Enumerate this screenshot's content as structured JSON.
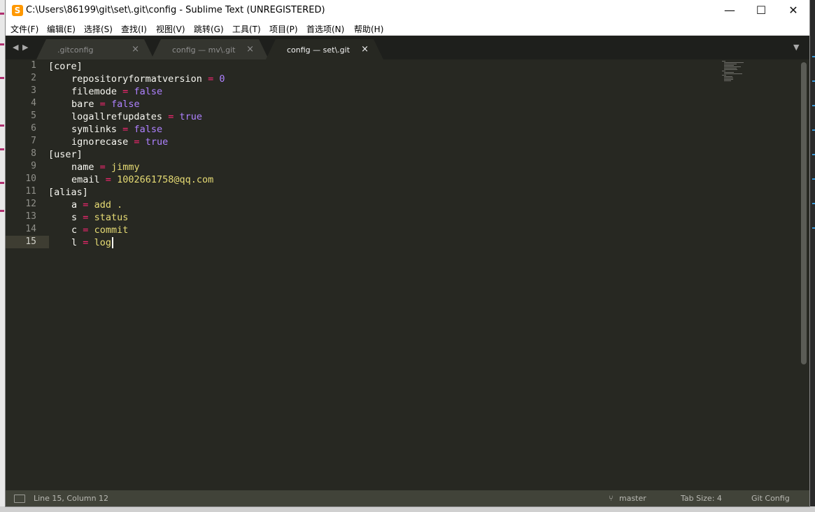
{
  "window": {
    "title": "C:\\Users\\86199\\git\\set\\.git\\config - Sublime Text (UNREGISTERED)",
    "app_icon_letter": "S",
    "accent_color": "#ff9800"
  },
  "controls": {
    "minimize": "—",
    "maximize": "☐",
    "close": "✕"
  },
  "menu": [
    "文件(F)",
    "编辑(E)",
    "选择(S)",
    "查找(I)",
    "视图(V)",
    "跳转(G)",
    "工具(T)",
    "项目(P)",
    "首选项(N)",
    "帮助(H)"
  ],
  "tabs": [
    {
      "label": ".gitconfig",
      "close": "×",
      "active": false
    },
    {
      "label": "config — mv\\.git",
      "close": "×",
      "active": false
    },
    {
      "label": "config — set\\.git",
      "close": "×",
      "active": true
    }
  ],
  "nav": {
    "back": "◀",
    "forward": "▶",
    "dropdown": "▼"
  },
  "editor": {
    "line_numbers": [
      "1",
      "2",
      "3",
      "4",
      "5",
      "6",
      "7",
      "8",
      "9",
      "10",
      "11",
      "12",
      "13",
      "14",
      "15"
    ],
    "current_line": 15,
    "lines": [
      {
        "section": "[core]"
      },
      {
        "key": "repositoryformatversion",
        "eq": "=",
        "value": "0",
        "type": "num"
      },
      {
        "key": "filemode",
        "eq": "=",
        "value": "false",
        "type": "const"
      },
      {
        "key": "bare",
        "eq": "=",
        "value": "false",
        "type": "const"
      },
      {
        "key": "logallrefupdates",
        "eq": "=",
        "value": "true",
        "type": "const"
      },
      {
        "key": "symlinks",
        "eq": "=",
        "value": "false",
        "type": "const"
      },
      {
        "key": "ignorecase",
        "eq": "=",
        "value": "true",
        "type": "const"
      },
      {
        "section": "[user]"
      },
      {
        "key": "name",
        "eq": "=",
        "value": "jimmy",
        "type": "str"
      },
      {
        "key": "email",
        "eq": "=",
        "value": "1002661758@qq.com",
        "type": "str"
      },
      {
        "section": "[alias]"
      },
      {
        "key": "a",
        "eq": "=",
        "value": "add .",
        "type": "str"
      },
      {
        "key": "s",
        "eq": "=",
        "value": "status",
        "type": "str"
      },
      {
        "key": "c",
        "eq": "=",
        "value": "commit",
        "type": "str"
      },
      {
        "key": "l",
        "eq": "=",
        "value": "log",
        "type": "str"
      }
    ]
  },
  "statusbar": {
    "position": "Line 15, Column 12",
    "branch": "master",
    "tab_size": "Tab Size: 4",
    "syntax": "Git Config"
  }
}
